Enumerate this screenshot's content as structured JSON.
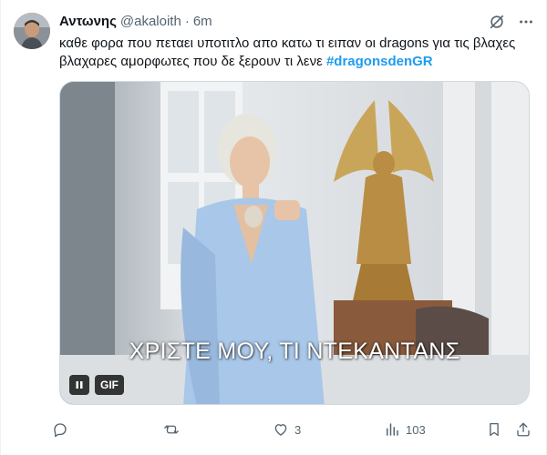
{
  "tweet": {
    "author_name": "Αντωνης",
    "handle": "@akaloith",
    "separator": "·",
    "time": "6m",
    "text": "καθε φορα που πεταει υποτιτλο απο κατω τι ειπαν οι dragons για τις βλαχες βλαχαρες αμορφωτες που δε ξερουν τι λενε ",
    "hashtag": "#dragonsdenGR"
  },
  "header_icons": [
    "grok-icon",
    "more-icon"
  ],
  "media": {
    "subtitle": "ΧΡΙΣΤΕ ΜΟΥ, ΤΙ ΝΤΕΚΑΝΤΑΝΣ",
    "gif_label": "GIF"
  },
  "actions": {
    "reply_count": "",
    "retweet_count": "",
    "like_count": "3",
    "views_count": "103"
  },
  "colors": {
    "text": "#0f1419",
    "muted": "#536471",
    "accent": "#1d9bf0",
    "border": "#cfd9de"
  }
}
